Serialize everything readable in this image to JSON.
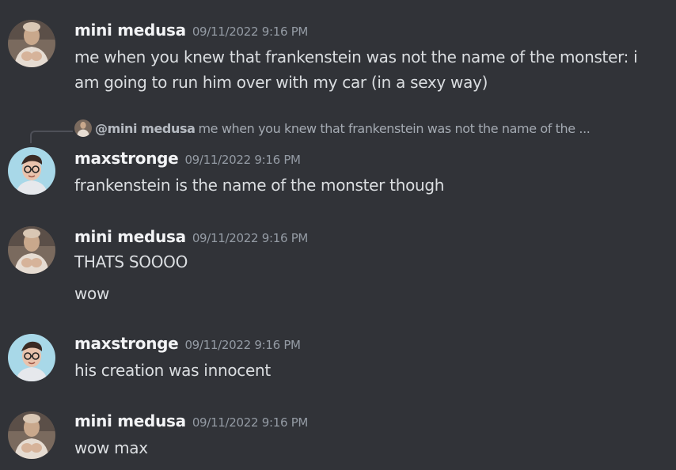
{
  "users": {
    "mini_medusa": "mini medusa",
    "maxstronge": "maxstronge"
  },
  "messages": [
    {
      "username": "mini medusa",
      "timestamp": "09/11/2022 9:16 PM",
      "lines": [
        "me when you knew that frankenstein was not the name of the monster: i",
        "am going to run him over with my car (in a sexy way)"
      ]
    },
    {
      "reply": {
        "mention": "@mini medusa",
        "preview": "me when you knew that frankenstein was not the name of the ..."
      },
      "username": "maxstronge",
      "timestamp": "09/11/2022 9:16 PM",
      "lines": [
        "frankenstein is the name of the monster though"
      ]
    },
    {
      "username": "mini medusa",
      "timestamp": "09/11/2022 9:16 PM",
      "lines": [
        "THATS SOOOO",
        "wow"
      ]
    },
    {
      "username": "maxstronge",
      "timestamp": "09/11/2022 9:16 PM",
      "lines": [
        "his creation was innocent"
      ]
    },
    {
      "username": "mini medusa",
      "timestamp": "09/11/2022 9:16 PM",
      "lines": [
        "wow max"
      ]
    }
  ],
  "colors": {
    "background": "#313338",
    "username": "#f2f3f5",
    "timestamp": "#949ba4",
    "message_text": "#dbdee1"
  },
  "icons": {
    "mini_medusa_avatar": "avatar-photo-icon",
    "maxstronge_avatar": "avatar-cartoon-icon"
  }
}
